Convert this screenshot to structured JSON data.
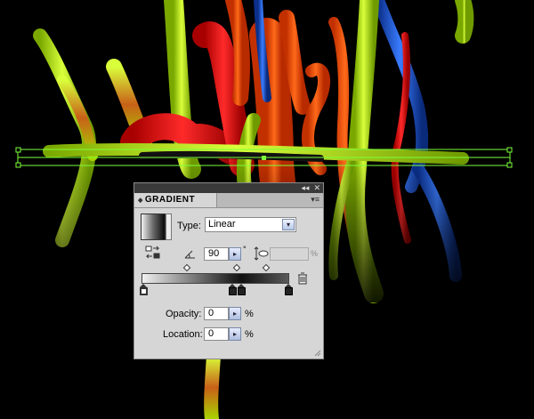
{
  "panel": {
    "title": "GRADIENT",
    "tab_arrows": "◆",
    "collapse_glyph": "◂◂",
    "close_glyph": "✕",
    "menu_glyph": "▾≡",
    "type_label": "Type:",
    "type_value": "Linear",
    "angle_value": "90",
    "degree_symbol": "°",
    "aspect_percent": "%",
    "opacity_label": "Opacity:",
    "opacity_value": "0",
    "opacity_unit": "%",
    "location_label": "Location:",
    "location_value": "0",
    "location_unit": "%",
    "stepper_glyph": "▸",
    "dropdown_glyph": "▾"
  },
  "icons": {
    "reverse": "reverse-gradient-icon",
    "angle": "angle-icon",
    "aspect": "aspect-ratio-icon",
    "trash": "delete-stop-icon"
  },
  "colors": {
    "lime": "#b6e000",
    "orange": "#ff4a00",
    "red": "#e60000",
    "blue": "#1a5ad6",
    "selection": "#7dff3a"
  }
}
